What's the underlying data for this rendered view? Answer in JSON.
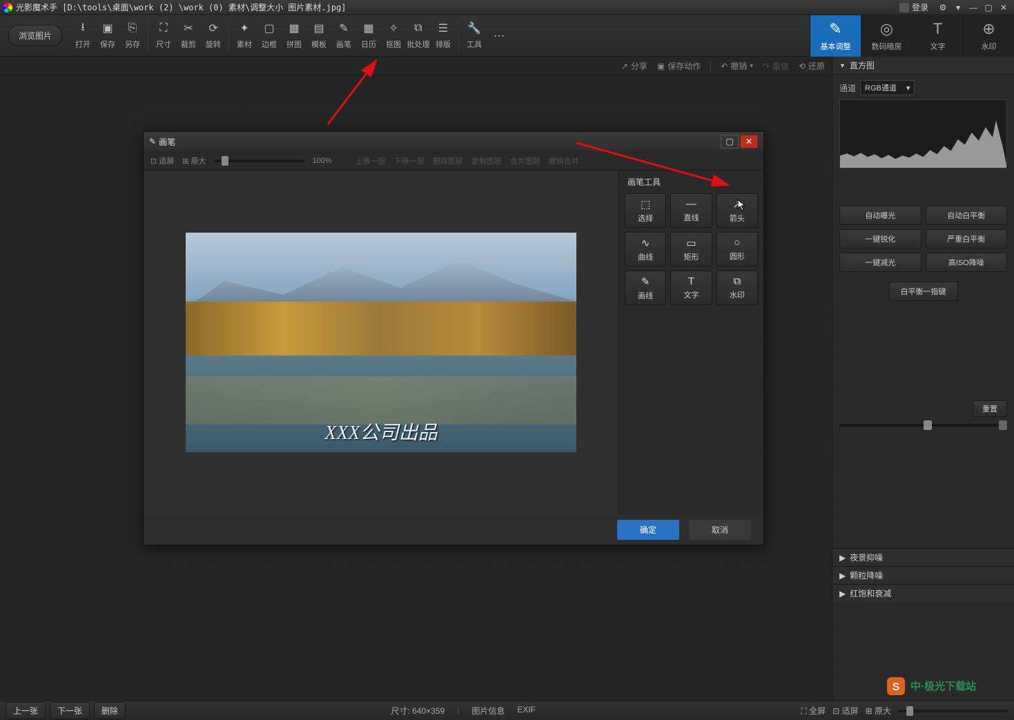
{
  "title": "光影魔术手 [D:\\tools\\桌面\\work (2) \\work (0) 素材\\调整大小 图片素材.jpg]",
  "login_label": "登录",
  "browse_label": "浏览图片",
  "toolbar": [
    {
      "id": "open",
      "label": "打开",
      "icon": "⭳"
    },
    {
      "id": "save",
      "label": "保存",
      "icon": "▣"
    },
    {
      "id": "saveas",
      "label": "另存",
      "icon": "⎘"
    },
    {
      "id": "div",
      "label": "",
      "icon": ""
    },
    {
      "id": "size",
      "label": "尺寸",
      "icon": "⛶"
    },
    {
      "id": "crop",
      "label": "裁剪",
      "icon": "✂"
    },
    {
      "id": "rotate",
      "label": "旋转",
      "icon": "⟳"
    },
    {
      "id": "div",
      "label": "",
      "icon": ""
    },
    {
      "id": "material",
      "label": "素材",
      "icon": "✦"
    },
    {
      "id": "frame",
      "label": "边框",
      "icon": "▢"
    },
    {
      "id": "puzzle",
      "label": "拼图",
      "icon": "▦"
    },
    {
      "id": "template",
      "label": "模板",
      "icon": "▤"
    },
    {
      "id": "brush",
      "label": "画笔",
      "icon": "✎"
    },
    {
      "id": "calendar",
      "label": "日历",
      "icon": "▦"
    },
    {
      "id": "cutout",
      "label": "抠图",
      "icon": "✧"
    },
    {
      "id": "batch",
      "label": "批处理",
      "icon": "⧉"
    },
    {
      "id": "layout",
      "label": "排版",
      "icon": "☰"
    },
    {
      "id": "div",
      "label": "",
      "icon": ""
    },
    {
      "id": "tools",
      "label": "工具",
      "icon": "🔧"
    },
    {
      "id": "more",
      "label": "",
      "icon": "⋯"
    }
  ],
  "righttabs": [
    {
      "id": "basic",
      "label": "基本调整",
      "icon": "✎",
      "active": true
    },
    {
      "id": "darkroom",
      "label": "数码暗房",
      "icon": "◎"
    },
    {
      "id": "text",
      "label": "文字",
      "icon": "T"
    },
    {
      "id": "watermark",
      "label": "水印",
      "icon": "⊕"
    }
  ],
  "secondbar": {
    "share": "分享",
    "save_action": "保存动作",
    "undo": "撤销",
    "redo": "重做",
    "restore": "还原"
  },
  "rightpanel": {
    "histogram_title": "直方图",
    "channel_label": "通道",
    "channel_value": "RGB通道",
    "auto_buttons": [
      "自动曝光",
      "自动白平衡",
      "一键锐化",
      "严重白平衡",
      "一键减光",
      "高ISO降噪"
    ],
    "wb_button": "白平衡一指键",
    "reset": "重置",
    "accordions": [
      "夜景抑噪",
      "颗粒降噪",
      "红饱和衰减"
    ]
  },
  "dialog": {
    "title": "画笔",
    "fit": "适屏",
    "orig": "原大",
    "zoom": "100%",
    "layer_ops": [
      "上移一层",
      "下移一层",
      "删除图层",
      "复制图层",
      "合并图层",
      "撤销合并"
    ],
    "tools_header": "画笔工具",
    "tools": [
      {
        "id": "select",
        "label": "选择",
        "icon": "⬚"
      },
      {
        "id": "line",
        "label": "直线",
        "icon": "—"
      },
      {
        "id": "arrow",
        "label": "箭头",
        "icon": "↗"
      },
      {
        "id": "curve",
        "label": "曲线",
        "icon": "∿"
      },
      {
        "id": "rect",
        "label": "矩形",
        "icon": "▭"
      },
      {
        "id": "circle",
        "label": "圆形",
        "icon": "○"
      },
      {
        "id": "draw",
        "label": "画线",
        "icon": "✎"
      },
      {
        "id": "text",
        "label": "文字",
        "icon": "T"
      },
      {
        "id": "wmark",
        "label": "水印",
        "icon": "⧉"
      }
    ],
    "ok": "确定",
    "cancel": "取消",
    "watermark_text": "XXX公司出品"
  },
  "bottombar": {
    "prev": "上一张",
    "next": "下一张",
    "delete": "删除",
    "size_label": "尺寸:",
    "size_value": "640×359",
    "info": "图片信息",
    "exif": "EXIF",
    "fullscreen": "全屏",
    "fit": "适屏",
    "orig": "原大"
  }
}
